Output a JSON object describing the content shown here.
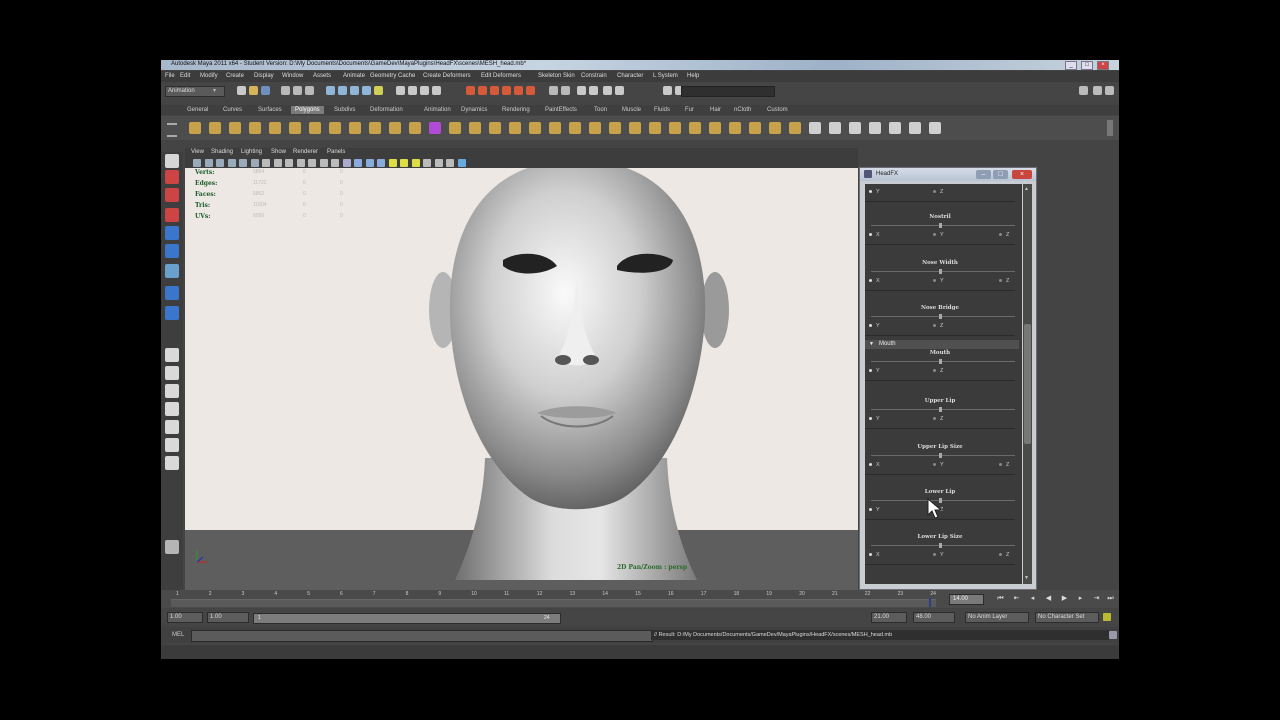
{
  "window": {
    "title": "Autodesk Maya 2011 x64 - Student Version: D:\\My Documents\\Documents\\GameDev\\MayaPlugins\\HeadFX\\scenes\\MESH_head.mb*"
  },
  "menubar": [
    "File",
    "Edit",
    "Modify",
    "Create",
    "Display",
    "Window",
    "Assets",
    "Animate",
    "Geometry Cache",
    "Create Deformers",
    "Edit Deformers",
    "Skeleton",
    "Skin",
    "Constrain",
    "Character",
    "L System",
    "Help"
  ],
  "statusline": {
    "mode": "Animation"
  },
  "shelf_tabs": [
    "General",
    "Curves",
    "Surfaces",
    "Polygons",
    "Subdivs",
    "Deformation",
    "Animation",
    "Dynamics",
    "Rendering",
    "PaintEffects",
    "Toon",
    "Muscle",
    "Fluids",
    "Fur",
    "Hair",
    "nCloth",
    "Custom"
  ],
  "viewport": {
    "menu": [
      "View",
      "Shading",
      "Lighting",
      "Show",
      "Renderer",
      "Panels"
    ],
    "hud": [
      {
        "label": "Verts:",
        "v1": "5864",
        "v2": "0",
        "v3": "0"
      },
      {
        "label": "Edges:",
        "v1": "11722",
        "v2": "0",
        "v3": "0"
      },
      {
        "label": "Faces:",
        "v1": "5862",
        "v2": "0",
        "v3": "0"
      },
      {
        "label": "Tris:",
        "v1": "11604",
        "v2": "0",
        "v3": "0"
      },
      {
        "label": "UVs:",
        "v1": "6056",
        "v2": "0",
        "v3": "0"
      }
    ],
    "camera_label": "2D Pan/Zoom : persp"
  },
  "timeline": {
    "ticks": [
      "1",
      "2",
      "3",
      "4",
      "5",
      "6",
      "7",
      "8",
      "9",
      "10",
      "11",
      "12",
      "13",
      "14",
      "15",
      "16",
      "17",
      "18",
      "19",
      "20",
      "21",
      "22",
      "23",
      "24"
    ],
    "current_time": "14.00"
  },
  "range": {
    "start": "1.00",
    "playback_start": "1.00",
    "marker_start": "1",
    "marker_end": "24",
    "playback_end": "21.00",
    "end": "48.00",
    "anim_layer": "No Anim Layer",
    "character_set": "No Character Set"
  },
  "command_line": {
    "label": "MEL",
    "result": "// Result: D:/My Documents/Documents/GameDev/MayaPlugins/HeadFX/scenes/MESH_head.mb"
  },
  "headfx": {
    "title": "HeadFX",
    "mouth_section": "Mouth",
    "sections": [
      {
        "title": "",
        "axes": [
          "Y",
          "Z"
        ]
      },
      {
        "title": "Nostril",
        "axes": [
          "X",
          "Y",
          "Z"
        ]
      },
      {
        "title": "Nose Width",
        "axes": [
          "X",
          "Y",
          "Z"
        ]
      },
      {
        "title": "Nose Bridge",
        "axes": [
          "Y",
          "Z"
        ]
      },
      {
        "title": "Mouth",
        "axes": [
          "Y",
          "Z"
        ]
      },
      {
        "title": "Upper Lip",
        "axes": [
          "Y",
          "Z"
        ]
      },
      {
        "title": "Upper Lip Size",
        "axes": [
          "X",
          "Y",
          "Z"
        ]
      },
      {
        "title": "Lower Lip",
        "axes": [
          "Y",
          "Z"
        ]
      },
      {
        "title": "Lower Lip Size",
        "axes": [
          "X",
          "Y",
          "Z"
        ]
      }
    ]
  },
  "colors": {
    "background": "#444444",
    "viewport_bg": "#ede8e4",
    "hud_green": "#1a5a2a",
    "shelf_active": "#7b7b7b"
  }
}
